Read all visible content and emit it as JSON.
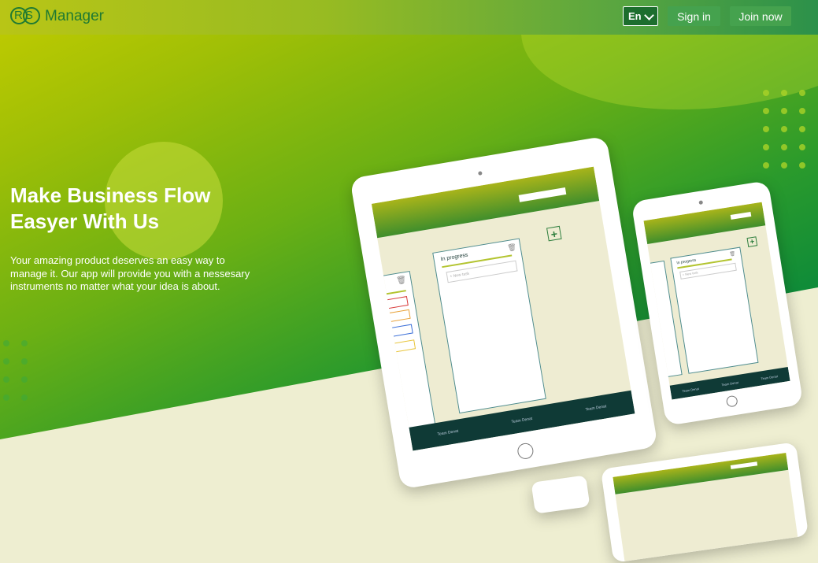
{
  "header": {
    "brand_letters": "RS",
    "brand_name": "Manager",
    "language": "En",
    "sign_in": "Sign in",
    "join_now": "Join now"
  },
  "hero": {
    "title": "Make Business Flow Easyer With Us",
    "description": "Your amazing product deserves an easy way to manage it. Our app will provide you with a nessesary instruments no matter what your idea is about."
  },
  "mockup": {
    "column_title": "In progress",
    "task_placeholder": "+ New task",
    "footer_links": [
      "Team Denat",
      "Team Denat",
      "Team Denat"
    ],
    "pill_colors": [
      "#d83b3b",
      "#e8a33b",
      "#3b6fd8",
      "#e8c53b"
    ]
  },
  "colors": {
    "brand": "#1f7a32",
    "button": "#45a24e",
    "background": "#eeeed1"
  }
}
